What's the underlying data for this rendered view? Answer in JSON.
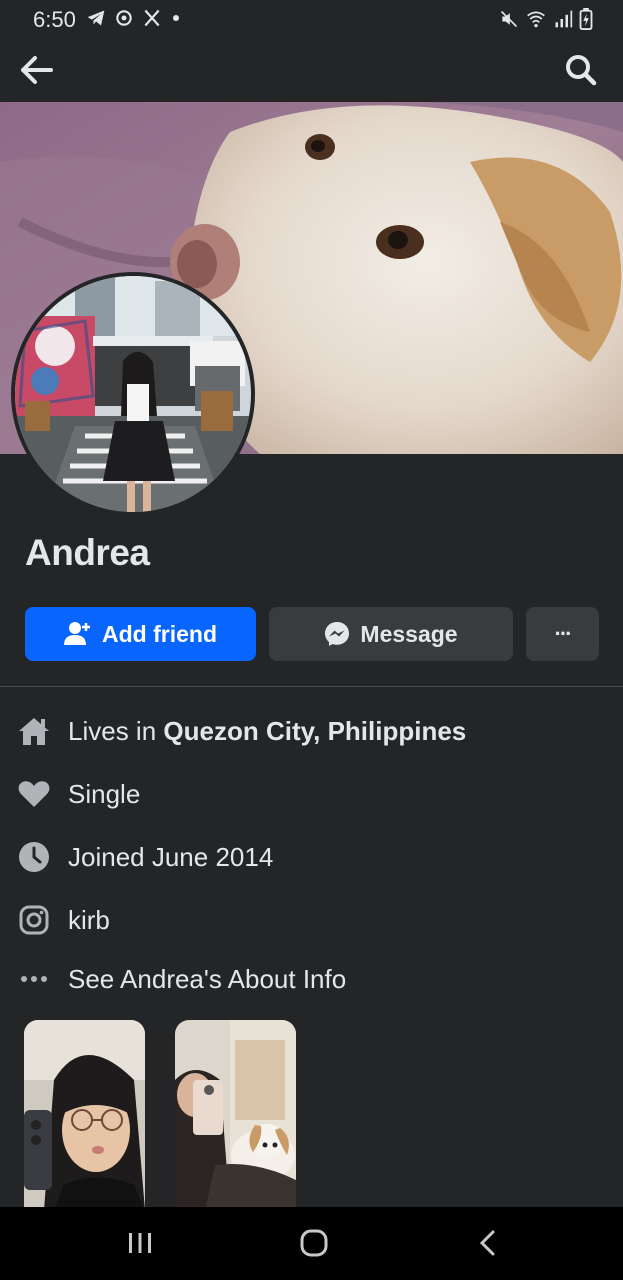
{
  "status_bar": {
    "time": "6:50",
    "left_icons": [
      "telegram-icon",
      "location-icon",
      "x-icon",
      "dot-icon"
    ],
    "right_icons": [
      "mute-icon",
      "wifi-icon",
      "signal-icon",
      "battery-icon"
    ]
  },
  "app_bar": {
    "back_icon": "arrow-left-icon",
    "search_icon": "search-icon"
  },
  "profile": {
    "name": "Andrea",
    "cover_alt": "dog photo",
    "avatar_alt": "profile photo"
  },
  "actions": {
    "add_friend": "Add friend",
    "message": "Message",
    "more": "···"
  },
  "info": {
    "lives_prefix": "Lives in ",
    "lives_place": "Quezon City, Philippines",
    "relationship": "Single",
    "joined": "Joined June 2014",
    "instagram": "kirb",
    "about": "See Andrea's About Info"
  },
  "colors": {
    "background": "#242526",
    "accent": "#0866ff",
    "button_secondary": "#3a3b3c",
    "text": "#e4e6eb"
  }
}
